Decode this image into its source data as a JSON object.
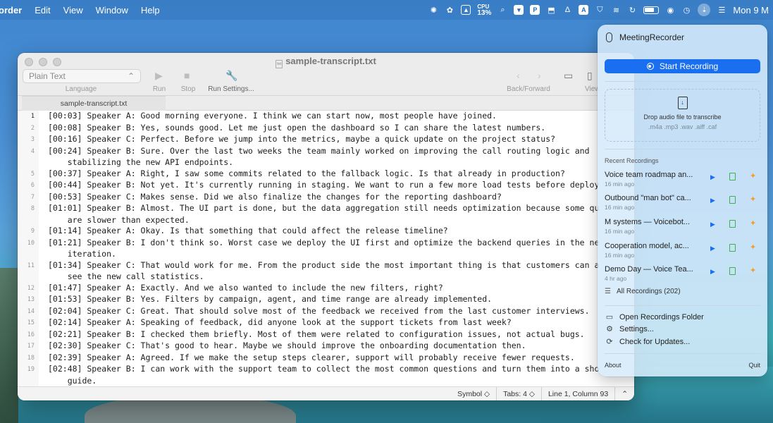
{
  "menubar": {
    "app_name": "order",
    "menus": [
      "Edit",
      "View",
      "Window",
      "Help"
    ],
    "cpu_label": "CPU",
    "cpu_value": "13%",
    "clock": "Mon 9 M"
  },
  "window": {
    "title": "sample-transcript.txt",
    "language_select": "Plain Text",
    "toolbar": {
      "language_label": "Language",
      "run_label": "Run",
      "stop_label": "Stop",
      "run_settings_label": "Run Settings...",
      "back_forward_label": "Back/Forward",
      "view_label": "View"
    },
    "tab_label": "sample-transcript.txt",
    "lines": [
      {
        "n": "1",
        "text": "[00:03] Speaker A: Good morning everyone. I think we can start now, most people have joined."
      },
      {
        "n": "2",
        "text": "[00:08] Speaker B: Yes, sounds good. Let me just open the dashboard so I can share the latest numbers."
      },
      {
        "n": "3",
        "text": "[00:16] Speaker C: Perfect. Before we jump into the metrics, maybe a quick update on the project status?"
      },
      {
        "n": "4",
        "text": "[00:24] Speaker B: Sure. Over the last two weeks the team mainly worked on improving the call routing logic and"
      },
      {
        "n": "",
        "text": "    stabilizing the new API endpoints."
      },
      {
        "n": "5",
        "text": "[00:37] Speaker A: Right, I saw some commits related to the fallback logic. Is that already in production?"
      },
      {
        "n": "6",
        "text": "[00:44] Speaker B: Not yet. It's currently running in staging. We want to run a few more load tests before deploy"
      },
      {
        "n": "7",
        "text": "[00:53] Speaker C: Makes sense. Did we also finalize the changes for the reporting dashboard?"
      },
      {
        "n": "8",
        "text": "[01:01] Speaker B: Almost. The UI part is done, but the data aggregation still needs optimization because some qu"
      },
      {
        "n": "",
        "text": "    are slower than expected."
      },
      {
        "n": "9",
        "text": "[01:14] Speaker A: Okay. Is that something that could affect the release timeline?"
      },
      {
        "n": "10",
        "text": "[01:21] Speaker B: I don't think so. Worst case we deploy the UI first and optimize the backend queries in the ne"
      },
      {
        "n": "",
        "text": "    iteration."
      },
      {
        "n": "11",
        "text": "[01:34] Speaker C: That would work for me. From the product side the most important thing is that customers can a"
      },
      {
        "n": "",
        "text": "    see the new call statistics."
      },
      {
        "n": "12",
        "text": "[01:47] Speaker A: Exactly. And we also wanted to include the new filters, right?"
      },
      {
        "n": "13",
        "text": "[01:53] Speaker B: Yes. Filters by campaign, agent, and time range are already implemented."
      },
      {
        "n": "14",
        "text": "[02:04] Speaker C: Great. That should solve most of the feedback we received from the last customer interviews."
      },
      {
        "n": "15",
        "text": "[02:14] Speaker A: Speaking of feedback, did anyone look at the support tickets from last week?"
      },
      {
        "n": "16",
        "text": "[02:21] Speaker B: I checked them briefly. Most of them were related to configuration issues, not actual bugs."
      },
      {
        "n": "17",
        "text": "[02:30] Speaker C: That's good to hear. Maybe we should improve the onboarding documentation then."
      },
      {
        "n": "18",
        "text": "[02:39] Speaker A: Agreed. If we make the setup steps clearer, support will probably receive fewer requests."
      },
      {
        "n": "19",
        "text": "[02:48] Speaker B: I can work with the support team to collect the most common questions and turn them into a sho"
      },
      {
        "n": "",
        "text": "    guide."
      },
      {
        "n": "20",
        "text": "[03:02] Speaker C: That would be very helpful."
      }
    ],
    "status": {
      "symbol": "Symbol ◇",
      "tabs": "Tabs: 4 ◇",
      "position": "Line 1, Column 93"
    }
  },
  "popover": {
    "app_name": "MeetingRecorder",
    "start_button": "Start Recording",
    "drop_text": "Drop audio file to transcribe",
    "drop_formats": ".m4a .mp3 .wav .aiff .caf",
    "recent_label": "Recent Recordings",
    "recordings": [
      {
        "title": "Voice team roadmap an...",
        "time": "16 min ago"
      },
      {
        "title": "Outbound \"man bot\" ca...",
        "time": "16 min ago"
      },
      {
        "title": "M systems — Voicebot...",
        "time": "16 min ago"
      },
      {
        "title": "Cooperation model, ac...",
        "time": "16 min ago"
      },
      {
        "title": "Demo Day — Voice Tea...",
        "time": "4 hr ago"
      }
    ],
    "all_recordings": "All Recordings (202)",
    "open_folder": "Open Recordings Folder",
    "settings": "Settings...",
    "check_updates": "Check for Updates...",
    "about": "About",
    "quit": "Quit"
  },
  "colors": {
    "accent": "#1a6ff0",
    "doc_green": "#3bb34a",
    "spark_orange": "#f39c2b"
  }
}
